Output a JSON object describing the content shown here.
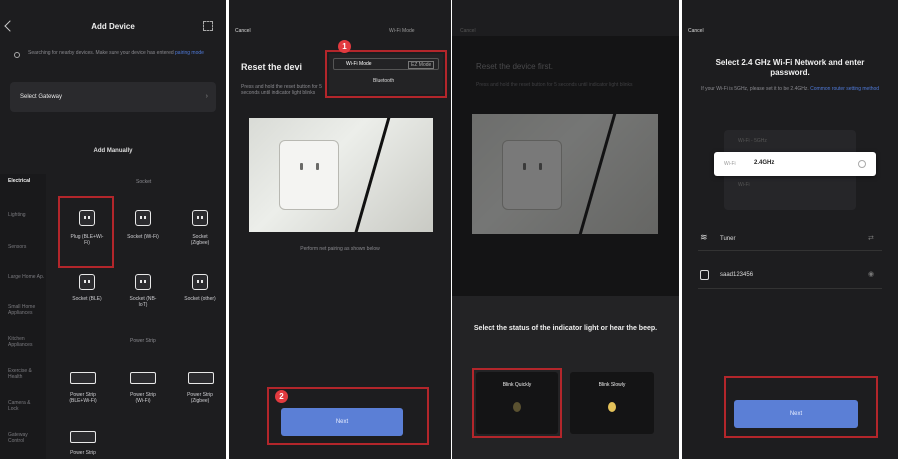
{
  "panel1": {
    "header": {
      "back_icon": "chevron-left-icon",
      "title": "Add Device",
      "scan_icon": "scan-icon"
    },
    "notice_text": "Searching for nearby devices. Make sure your device has entered",
    "notice_link": "pairing mode",
    "select_gateway": "Select Gateway",
    "add_manually": "Add Manually",
    "categories": [
      "Electrical",
      "Lighting",
      "Sensors",
      "Large Home Ap.",
      "Small Home Appliances",
      "Kitchen Appliances",
      "Exercise & Health",
      "Camera & Lock",
      "Gateway Control"
    ],
    "section_labels": [
      "Socket",
      "Power Strip"
    ],
    "devices": [
      {
        "label": "Plug (BLE+Wi-Fi)",
        "icon": "plug-icon"
      },
      {
        "label": "Socket (Wi-Fi)",
        "icon": "plug-icon"
      },
      {
        "label": "Socket (Zigbee)",
        "icon": "plug-icon"
      },
      {
        "label": "Socket (BLE)",
        "icon": "plug-icon"
      },
      {
        "label": "Socket (NB-IoT)",
        "icon": "plug-icon"
      },
      {
        "label": "Socket (other)",
        "icon": "plug-icon"
      },
      {
        "label": "Power Strip (BLE+Wi-Fi)",
        "icon": "power-strip-icon"
      },
      {
        "label": "Power Strip (Wi-Fi)",
        "icon": "power-strip-icon"
      },
      {
        "label": "Power Strip (Zigbee)",
        "icon": "power-strip-icon"
      },
      {
        "label": "Power Strip",
        "icon": "power-strip-icon"
      }
    ]
  },
  "panel2": {
    "cancel": "Cancel",
    "mode_selector": "Wi-Fi Mode",
    "title": "Reset the devi",
    "subtitle": "Press and hold the reset button for 5 seconds until indicator light blinks",
    "mode_options": [
      "Wi-Fi Mode",
      "EZ Mode",
      "Bluetooth"
    ],
    "caption": "Perform net pairing as shown below",
    "next_label": "Next",
    "badges": [
      "1",
      "2"
    ]
  },
  "panel3": {
    "cancel": "Cancel",
    "title": "Reset the device first.",
    "subtitle": "Press and hold the reset button for 5 seconds until indicator light blinks",
    "sheet_title": "Select the status of the indicator light or hear the beep.",
    "option_fast": "Blink Quickly",
    "option_slow": "Blink Slowly"
  },
  "panel4": {
    "cancel": "Cancel",
    "title": "Select 2.4 GHz Wi-Fi Network and enter password.",
    "subtitle": "If your Wi-Fi is 5GHz, please set it to be 2.4GHz.",
    "subtitle_link": "Common router setting method",
    "network_row_top": "Wi-Fi - 5GHz",
    "network_row_selected_prefix": "Wi-Fi",
    "network_row_selected": "2.4GHz",
    "network_row_bottom": "Wi-Fi",
    "wifi_name": "Tuner",
    "password": "saad123456",
    "next_label": "Next"
  }
}
